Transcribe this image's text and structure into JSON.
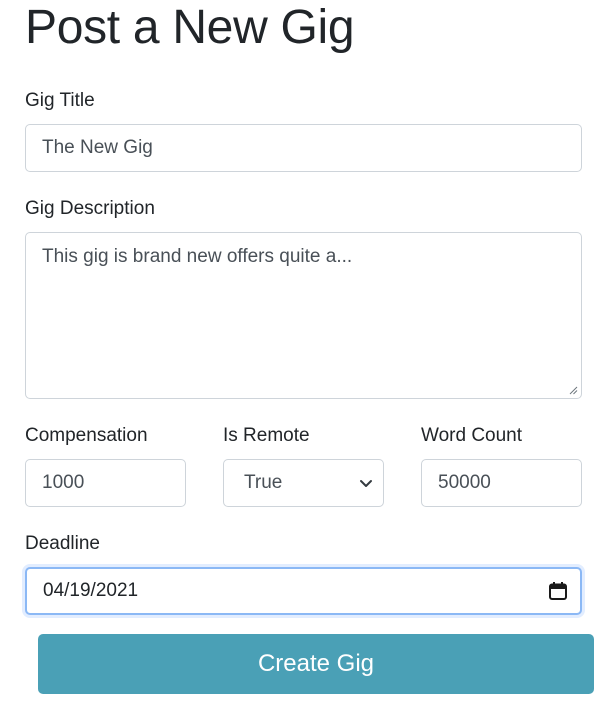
{
  "page": {
    "title": "Post a New Gig"
  },
  "form": {
    "title_label": "Gig Title",
    "title_value": "The New Gig",
    "description_label": "Gig Description",
    "description_value": "This gig is brand new offers quite a...",
    "compensation_label": "Compensation",
    "compensation_value": "1000",
    "remote_label": "Is Remote",
    "remote_value": "True",
    "word_count_label": "Word Count",
    "word_count_value": "50000",
    "deadline_label": "Deadline",
    "deadline_value": "04/19/2021",
    "submit_label": "Create Gig"
  },
  "icons": {
    "select": "chevron-down-icon",
    "date": "calendar-icon",
    "textarea": "resize-grip-icon"
  },
  "colors": {
    "button": "#4aa0b6",
    "focus_border": "#8bb8f5",
    "input_border": "#ced4da"
  }
}
